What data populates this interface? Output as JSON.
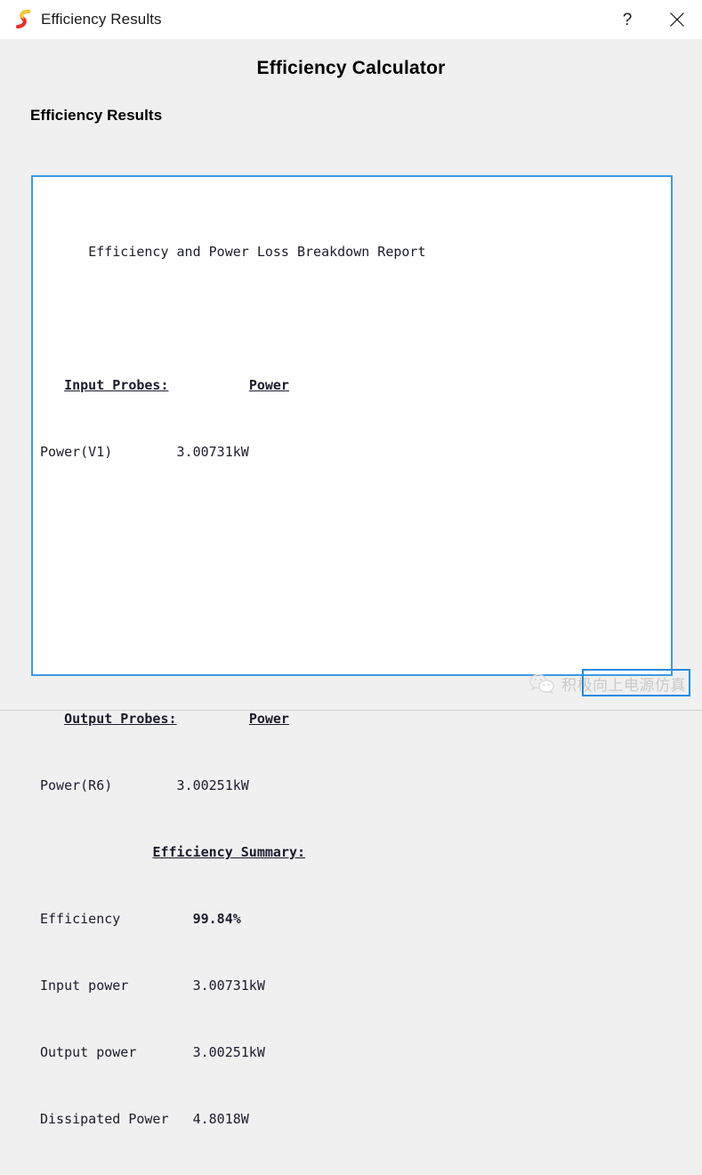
{
  "window": {
    "title": "Efficiency Results",
    "icon": "simetrix-s-logo-icon",
    "help_button_label": "?",
    "close_button_label": "✕"
  },
  "page": {
    "heading": "Efficiency Calculator",
    "section_label": "Efficiency Results"
  },
  "report": {
    "title": "Efficiency and Power Loss Breakdown Report",
    "input_section": {
      "header_left": "Input Probes:",
      "header_right": "Power",
      "rows": [
        {
          "label": "Power(V1)",
          "value": "3.00731kW"
        }
      ]
    },
    "output_section": {
      "header_left": "Output Probes:",
      "header_right": "Power",
      "rows": [
        {
          "label": "Power(R6)",
          "value": "3.00251kW"
        }
      ]
    },
    "summary": {
      "header": "Efficiency Summary:",
      "rows": [
        {
          "label": "Efficiency",
          "value": "99.84%",
          "bold": true
        },
        {
          "label": "Input power",
          "value": "3.00731kW",
          "bold": false
        },
        {
          "label": "Output power",
          "value": "3.00251kW",
          "bold": false
        },
        {
          "label": "Dissipated Power",
          "value": "4.8018W",
          "bold": false
        }
      ]
    }
  },
  "watermark": {
    "icon": "wechat-icon",
    "text": "积极向上电源仿真"
  },
  "colors": {
    "accent_border": "#3d9ae2",
    "selection_border": "#1e8ae0",
    "window_bg": "#f0f0f0",
    "titlebar_bg": "#ffffff",
    "report_text": "#1c1c2e",
    "logo_yellow": "#f5bd1f",
    "logo_red": "#e8312a"
  }
}
